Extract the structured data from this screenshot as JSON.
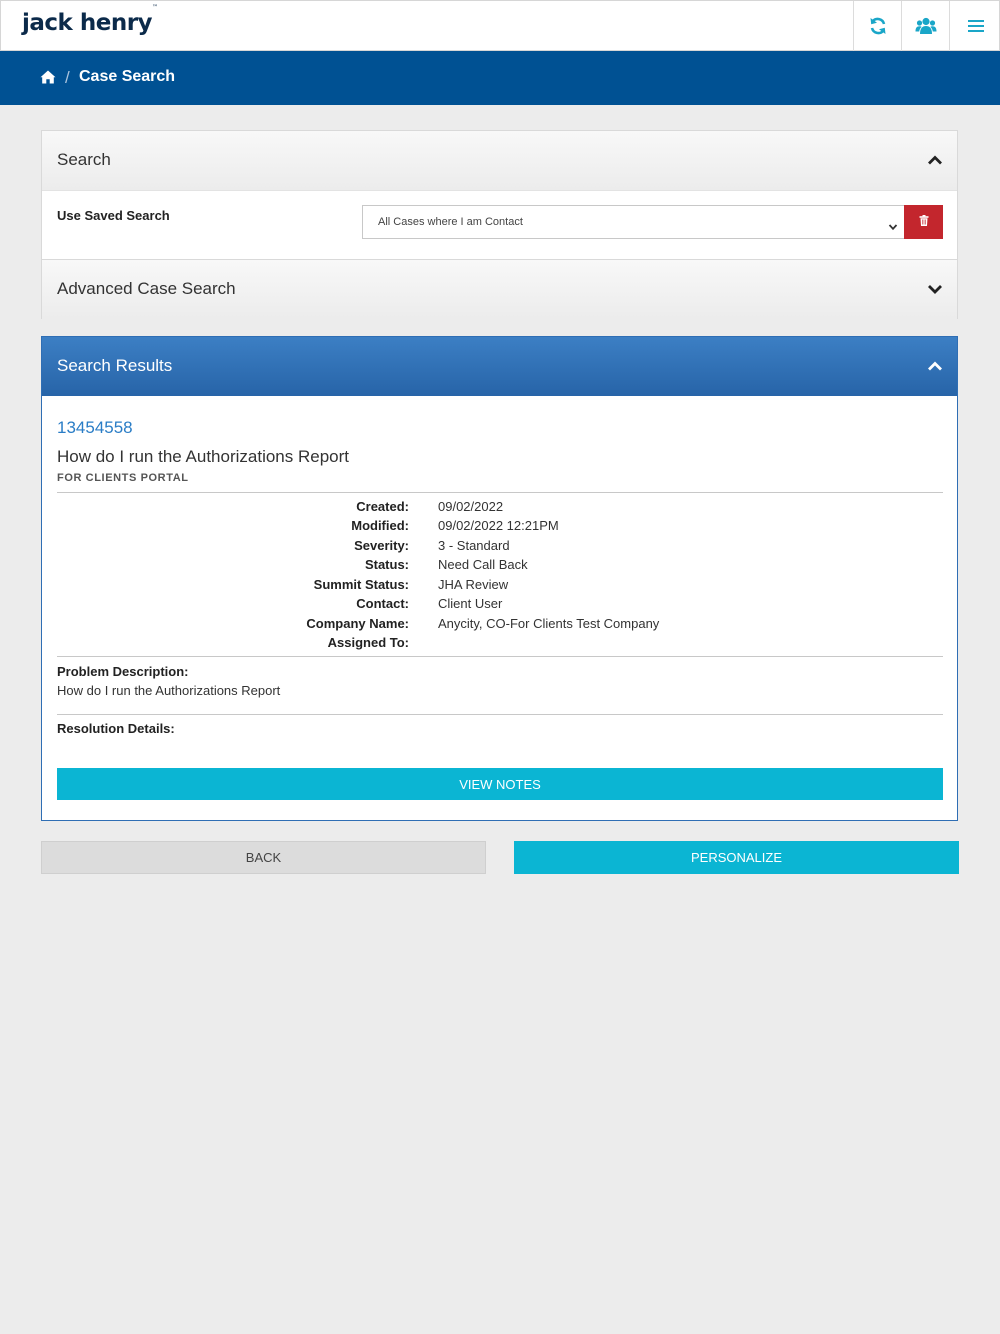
{
  "header": {
    "logo": "jack henry",
    "logo_mark": "™",
    "icons": [
      "refresh-icon",
      "users-icon",
      "menu-icon"
    ],
    "icon_color": "#1aa6c8"
  },
  "breadcrumb": {
    "home_icon": "home-icon",
    "separator": "/",
    "current": "Case Search"
  },
  "search_panel": {
    "title": "Search",
    "saved_search_label": "Use Saved Search",
    "saved_search_value": "All Cases where I am Contact",
    "delete_icon": "trash-icon"
  },
  "advanced_panel": {
    "title": "Advanced Case Search"
  },
  "results_panel": {
    "title": "Search Results",
    "case": {
      "number": "13454558",
      "title": "How do I run the Authorizations Report",
      "category": "FOR CLIENTS PORTAL",
      "fields": [
        {
          "label": "Created:",
          "value": "09/02/2022"
        },
        {
          "label": "Modified:",
          "value": "09/02/2022 12:21PM"
        },
        {
          "label": "Severity:",
          "value": "3 - Standard"
        },
        {
          "label": "Status:",
          "value": "Need Call Back"
        },
        {
          "label": "Summit Status:",
          "value": "JHA Review"
        },
        {
          "label": "Contact:",
          "value": "Client User"
        },
        {
          "label": "Company Name:",
          "value": "Anycity, CO-For Clients Test Company"
        },
        {
          "label": "Assigned To:",
          "value": ""
        }
      ],
      "problem_label": "Problem Description:",
      "problem_text": "How do I run the Authorizations Report",
      "resolution_label": "Resolution Details:",
      "resolution_text": ""
    },
    "view_notes_label": "VIEW NOTES"
  },
  "footer_buttons": {
    "back_label": "BACK",
    "personalize_label": "PERSONALIZE"
  },
  "colors": {
    "brand_navy": "#005193",
    "accent_cyan": "#0bb5d3",
    "danger_red": "#c3262d",
    "link_blue": "#2a7dc6"
  }
}
